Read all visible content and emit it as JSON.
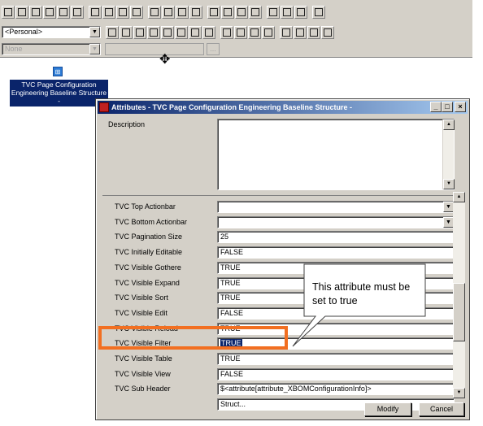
{
  "toolbar": {
    "row1_icons": [
      "open-icon",
      "find-icon",
      "search-icon",
      "navigate-icon",
      "attach-icon",
      "mail-icon",
      "document-icon",
      "page-icon",
      "report-icon",
      "print-preview-icon",
      "promote-icon",
      "list-icon",
      "tree-icon",
      "columns-icon",
      "expand-icon",
      "connect-icon",
      "edit-icon",
      "link-icon",
      "book-icon",
      "grid-icon",
      "table-icon",
      "print-icon"
    ],
    "row2_icons": [
      "structure-icon",
      "move-icon",
      "hierarchy-icon",
      "branch-icon",
      "dots-icon",
      "wizard-icon",
      "check-icon",
      "forward-icon",
      "bookmark-icon",
      "delete-icon",
      "lock-icon",
      "key-icon",
      "window-1-icon",
      "window-2-icon",
      "window-3-icon",
      "window-4-icon"
    ],
    "personal_combo_value": "<Personal>",
    "none_combo_value": "None",
    "small_button_label": "..."
  },
  "tree_node": {
    "icon": "structure-node-icon",
    "label_line1": "TVC Page Configuration",
    "label_line2": "Engineering Baseline Structure",
    "label_line3": "-"
  },
  "dialog": {
    "title": "Attributes - TVC Page Configuration Engineering Baseline Structure -",
    "min_label": "_",
    "max_label": "□",
    "close_label": "×",
    "description_label": "Description",
    "rows": [
      {
        "label": "TVC Top Actionbar",
        "value": "",
        "dropdown": true
      },
      {
        "label": "TVC Bottom Actionbar",
        "value": "",
        "dropdown": true
      },
      {
        "label": "TVC Pagination Size",
        "value": "25"
      },
      {
        "label": "TVC Initially Editable",
        "value": "FALSE"
      },
      {
        "label": "TVC Visible Gothere",
        "value": "TRUE"
      },
      {
        "label": "TVC Visible Expand",
        "value": "TRUE"
      },
      {
        "label": "TVC Visible Sort",
        "value": "TRUE"
      },
      {
        "label": "TVC Visible Edit",
        "value": "FALSE"
      },
      {
        "label": "TVC Visible Reload",
        "value": "TRUE"
      },
      {
        "label": "TVC Visible Filter",
        "value": "TRUE",
        "selected": true
      },
      {
        "label": "TVC Visible Table",
        "value": "TRUE"
      },
      {
        "label": "TVC Visible View",
        "value": "FALSE"
      },
      {
        "label": "TVC Sub Header",
        "value": "$<attribute[attribute_XBOMConfigurationInfo]>"
      },
      {
        "label": "",
        "value": "Struct..."
      }
    ],
    "modify_label": "Modify",
    "cancel_label": "Cancel"
  },
  "annotation": {
    "callout_text": "This attribute must be set to true",
    "highlight_color": "#f26f21"
  }
}
